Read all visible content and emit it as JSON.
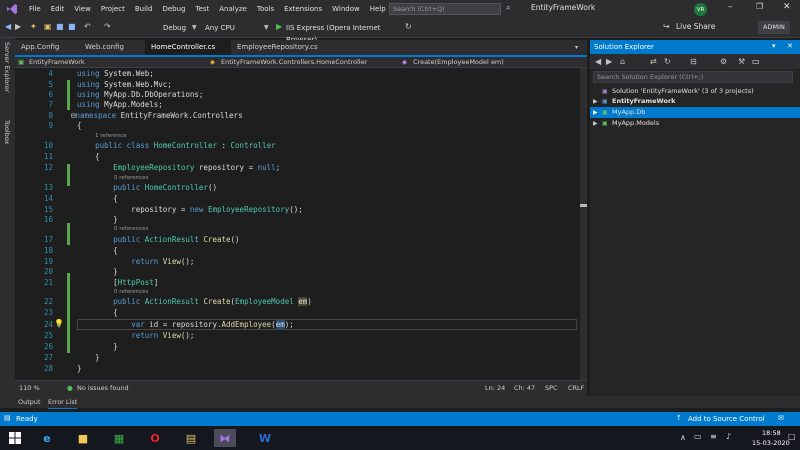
{
  "menubar": {
    "items": [
      "File",
      "Edit",
      "View",
      "Project",
      "Build",
      "Debug",
      "Test",
      "Analyze",
      "Tools",
      "Extensions",
      "Window",
      "Help"
    ],
    "search_placeholder": "Search (Ctrl+Q)",
    "solution_name": "EntityFrameWork",
    "avatar_initials": "VR"
  },
  "toolbar": {
    "config": "Debug",
    "platform": "Any CPU",
    "run_target": "IIS Express (Opera Internet Browser)",
    "live_share": "Live Share",
    "admin": "ADMIN"
  },
  "left_strip": {
    "server_explorer": "Server Explorer",
    "toolbox": "Toolbox"
  },
  "doc_tabs": [
    "App.Config",
    "Web.config",
    "HomeController.cs",
    "EmployeeRepository.cs"
  ],
  "nav": {
    "project": "EntityFrameWork",
    "type": "EntityFrameWork.Controllers.HomeController",
    "member": "Create(EmployeeModel em)"
  },
  "code": {
    "line_numbers": [
      "4",
      "5",
      "6",
      "7",
      "8",
      "9",
      "10",
      "11",
      "12",
      "13",
      "14",
      "15",
      "16",
      "17",
      "18",
      "19",
      "20",
      "21",
      "22",
      "23",
      "24",
      "25",
      "26",
      "27",
      "28"
    ],
    "lines": [
      "using System.Web;",
      "using System.Web.Mvc;",
      "using MyApp.Db.DbOperations;",
      "using MyApp.Models;",
      "namespace EntityFrameWork.Controllers",
      "{",
      "    public class HomeController : Controller",
      "    {",
      "        EmployeeRepository repository = null;",
      "        public HomeController()",
      "        {",
      "            repository = new EmployeeRepository();",
      "        }",
      "        public ActionResult Create()",
      "        {",
      "            return View();",
      "        }",
      "        [HttpPost]",
      "        public ActionResult Create(EmployeeModel em)",
      "        {",
      "            var id = repository.AddEmployee(em);",
      "            return View();",
      "        }",
      "    }",
      "}"
    ],
    "ref_1": "1 reference",
    "ref_0": "0 references"
  },
  "solution_explorer": {
    "title": "Solution Explorer",
    "search_placeholder": "Search Solution Explorer (Ctrl+;)",
    "solution": "Solution 'EntityFrameWork' (3 of 3 projects)",
    "projects": [
      "EntityFrameWork",
      "MyApp.Db",
      "MyApp.Models"
    ]
  },
  "editor_status": {
    "zoom": "110 %",
    "issues": "No issues found",
    "ln": "Ln: 24",
    "ch": "Ch: 47",
    "spc": "SPC",
    "crlf": "CRLF"
  },
  "bottom_tabs": [
    "Output",
    "Error List"
  ],
  "statusbar": {
    "ready": "Ready",
    "source_control": "Add to Source Control"
  },
  "taskbar": {
    "time": "18:58",
    "date": "15-03-2020"
  },
  "colors": {
    "accent": "#007acc",
    "editor_bg": "#1e1e1e",
    "chrome": "#2d2d30"
  }
}
